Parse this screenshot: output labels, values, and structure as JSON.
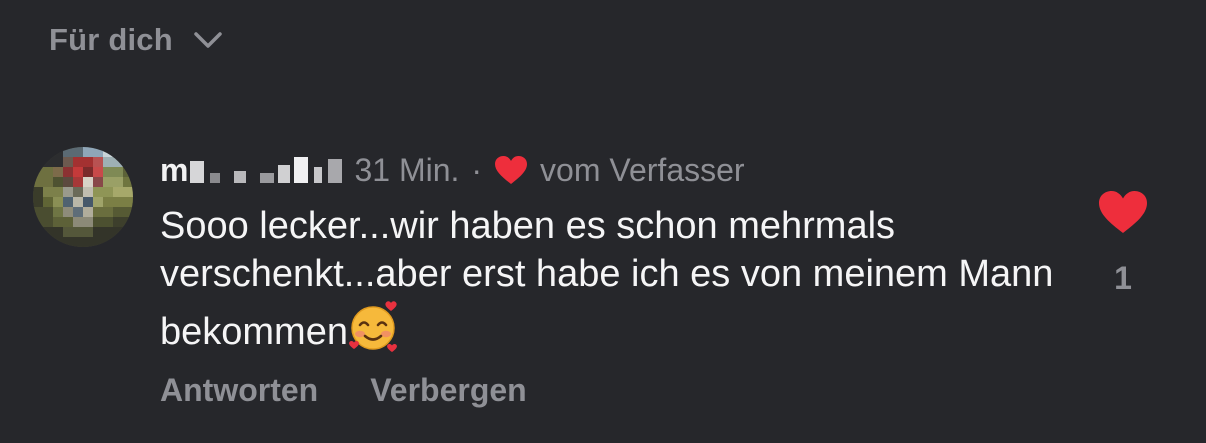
{
  "sort": {
    "label": "Für dich",
    "icon": "chevron-down-icon"
  },
  "comment": {
    "username_visible": "m",
    "timestamp": "31 Min.",
    "separator": "·",
    "author_liked_label": "vom Verfasser",
    "author_liked_icon": "heart-icon",
    "text": "Sooo lecker...wir haben es schon mehrmals verschenkt...aber erst habe ich es von meinem Mann bekommen",
    "emoji": "smiling-face-with-hearts",
    "like_count": "1",
    "like_icon": "heart-icon"
  },
  "actions": {
    "reply": "Antworten",
    "hide": "Verbergen"
  },
  "colors": {
    "background": "#26272b",
    "text_primary": "#f5f5f6",
    "text_secondary": "#8f9096",
    "heart_red": "#ee2e3c"
  }
}
